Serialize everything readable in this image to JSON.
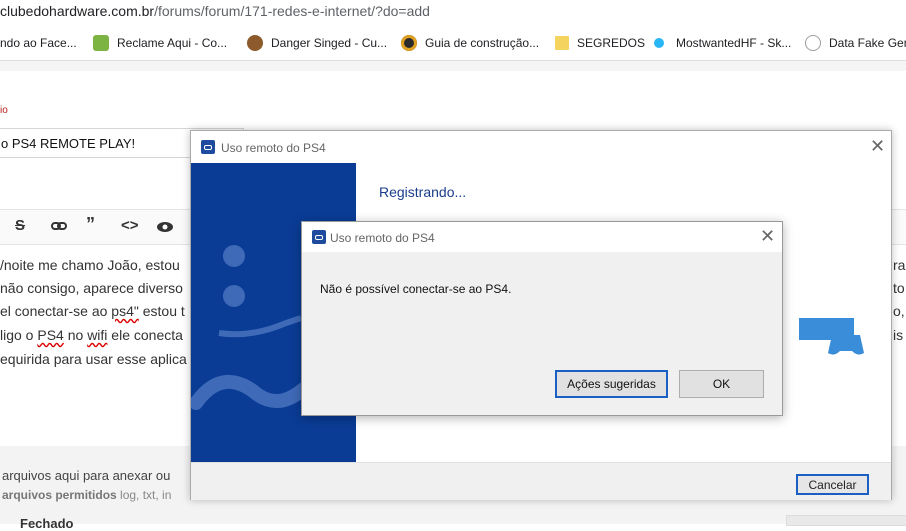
{
  "browser": {
    "url_domain": "clubedohardware.com.br",
    "url_path": "/forums/forum/171-redes-e-internet/?do=add",
    "bookmarks": [
      {
        "label": "ndo ao Face...",
        "icon": "facebook-icon",
        "color": "#3b5998"
      },
      {
        "label": "Reclame Aqui - Co...",
        "icon": "reclame-aqui-icon",
        "color": "#7cb342"
      },
      {
        "label": "Danger Singed - Cu...",
        "icon": "champion-avatar-icon",
        "color": "#8d5a2b"
      },
      {
        "label": "Guia de construção...",
        "icon": "game-logo-icon",
        "color": "#2b2b2b"
      },
      {
        "label": "SEGREDOS",
        "icon": "folder-icon",
        "color": "#f4d35e"
      },
      {
        "label": "MostwantedHF - Sk...",
        "icon": "sparkle-icon",
        "color": "#29b6f6"
      },
      {
        "label": "Data Fake Gene",
        "icon": "globe-icon",
        "color": "#9e9e9e"
      }
    ]
  },
  "forum": {
    "field_label": "io",
    "title_value": "o PS4 REMOTE PLAY!",
    "toolbar_icons": [
      "strikethrough-icon",
      "link-icon",
      "quote-icon",
      "code-icon",
      "preview-icon"
    ],
    "body_lines": [
      {
        "pre": "/noite me chamo João, estou",
        "u": "",
        "post": ""
      },
      {
        "pre": " não consigo, aparece diverso",
        "u": "",
        "post": ""
      },
      {
        "pre": "el conectar-se ao ",
        "u": "ps4\"",
        "post": " estou t"
      },
      {
        "pre": "ligo o ",
        "u": "PS4",
        "post": " no "
      },
      {
        "pre": "equirida para usar esse aplica",
        "u": "",
        "post": ""
      }
    ],
    "body_line4_tail": {
      "u": "wifi",
      "post": " ele conecta"
    },
    "right_cut": [
      "rac",
      "to",
      "o, p",
      "is"
    ],
    "attach_line": "arquivos aqui para anexar ou",
    "attach_allowed_label": "arquivos permitidos",
    "attach_allowed_types": " log, txt, in",
    "bottom_cut": "Fechado"
  },
  "ps4_window": {
    "title": "Uso remoto do PS4",
    "status": "Registrando...",
    "cancel_label": "Cancelar"
  },
  "error_dialog": {
    "title": "Uso remoto do PS4",
    "message": "Não é possível conectar-se ao PS4.",
    "suggested_label": "Ações sugeridas",
    "ok_label": "OK"
  }
}
